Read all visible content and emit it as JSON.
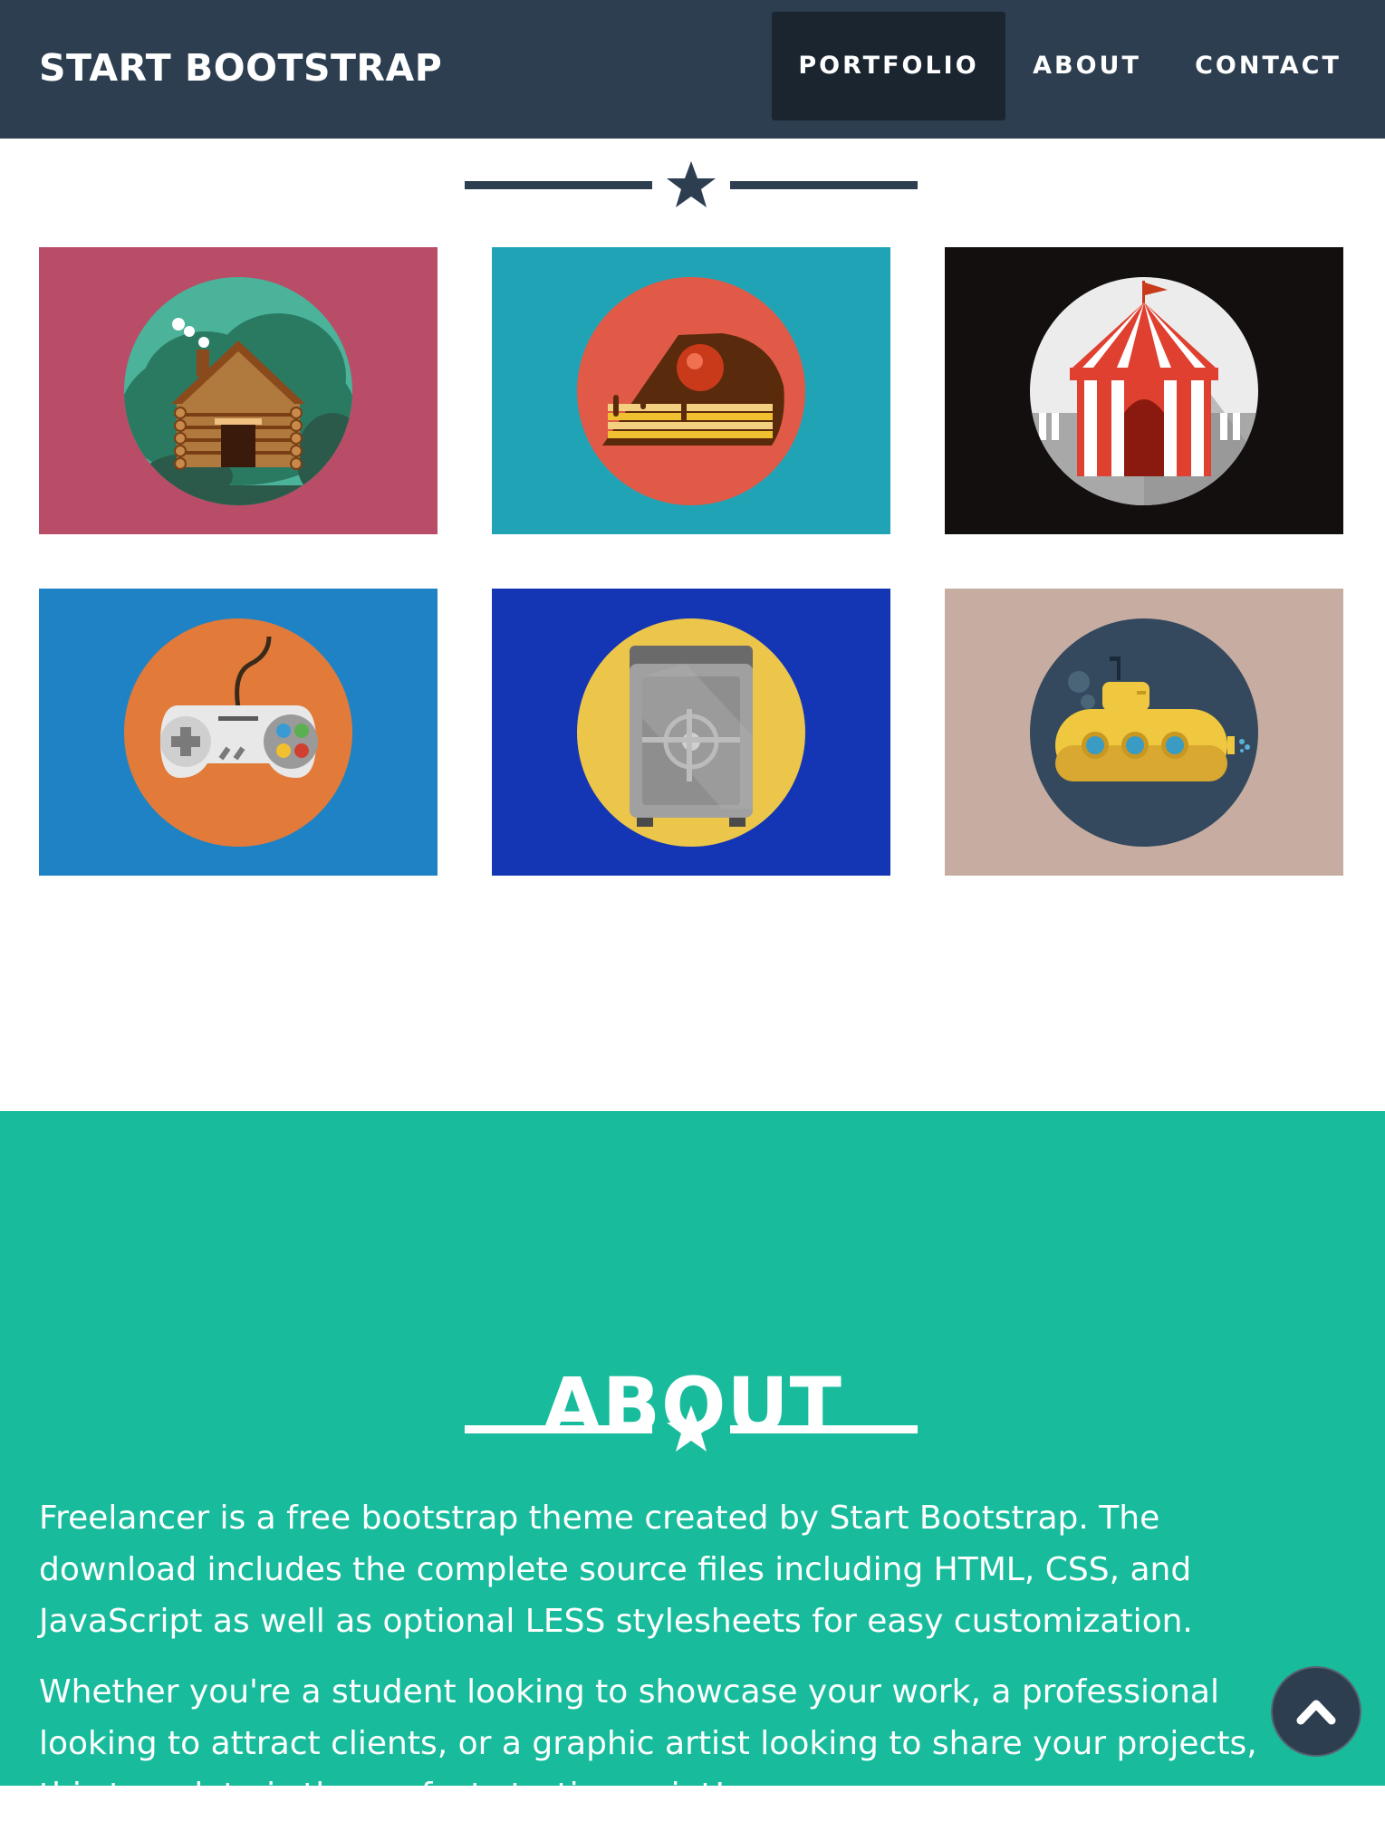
{
  "navbar": {
    "brand": "START BOOTSTRAP",
    "items": [
      {
        "label": "PORTFOLIO",
        "active": true
      },
      {
        "label": "ABOUT",
        "active": false
      },
      {
        "label": "CONTACT",
        "active": false
      }
    ]
  },
  "portfolio": {
    "items": [
      {
        "name": "cabin",
        "background": "#b94d67",
        "circle": "#2a9a7f"
      },
      {
        "name": "cake",
        "background": "#20a4b5",
        "circle": "#e05a47"
      },
      {
        "name": "circus",
        "background": "#130f0e",
        "circle": "#ececec"
      },
      {
        "name": "game",
        "background": "#1f82c4",
        "circle": "#e27b3a"
      },
      {
        "name": "safe",
        "background": "#1436b5",
        "circle": "#ecc64a"
      },
      {
        "name": "submarine",
        "background": "#c7ada1",
        "circle": "#34495e"
      }
    ]
  },
  "about": {
    "title": "ABOUT",
    "paragraphs": [
      "Freelancer is a free bootstrap theme created by Start Bootstrap. The download includes the complete source files including HTML, CSS, and JavaScript as well as optional LESS stylesheets for easy customization.",
      "Whether you're a student looking to showcase your work, a professional looking to attract clients, or a graphic artist looking to share your projects, this template is the perfect starting point!"
    ]
  },
  "colors": {
    "navbar": "#2c3e50",
    "navbar_active": "#1a252f",
    "about_bg": "#18bc9c",
    "divider_dark": "#2c3e50",
    "divider_light": "#ffffff"
  },
  "icons": {
    "divider": "star-icon",
    "scroll_top": "chevron-up-icon"
  }
}
